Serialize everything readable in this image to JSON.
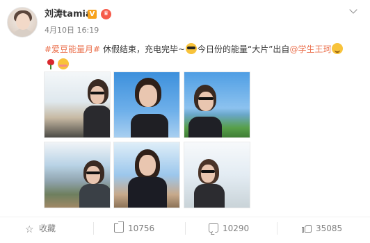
{
  "post": {
    "username": "刘涛tamia",
    "verified_badge": "V",
    "member_badge": "♛",
    "timestamp": "4月10日 16:19",
    "text": {
      "hashtag": "#爱豆能量月#",
      "part1": " 休假结束，充电完毕~",
      "part2": "今日份的能量“大片”出自",
      "mention": "@学生王珂"
    },
    "emojis": [
      "sunglasses-emoji",
      "peek-emoji",
      "rose-emoji",
      "blush-emoji"
    ]
  },
  "photos": [
    {
      "name": "photo-1",
      "sky": "#dfe8ee",
      "coat": "#2a2a2e"
    },
    {
      "name": "photo-2",
      "sky": "#4a9be0",
      "coat": "#1f1f24"
    },
    {
      "name": "photo-3",
      "sky": "#5aa6e8",
      "coat": "#1f2026"
    },
    {
      "name": "photo-4",
      "sky": "#b9d3e6",
      "coat": "#3a4046"
    },
    {
      "name": "photo-5",
      "sky": "#9cc7ec",
      "coat": "#1b1c24"
    },
    {
      "name": "photo-6",
      "sky": "#e3ecf3",
      "coat": "#2c2c30"
    }
  ],
  "actions": {
    "favorite_label": "收藏",
    "repost_count": "10756",
    "comment_count": "10290",
    "like_count": "35085"
  },
  "colors": {
    "accent": "#eb7350",
    "text_muted": "#808080"
  }
}
